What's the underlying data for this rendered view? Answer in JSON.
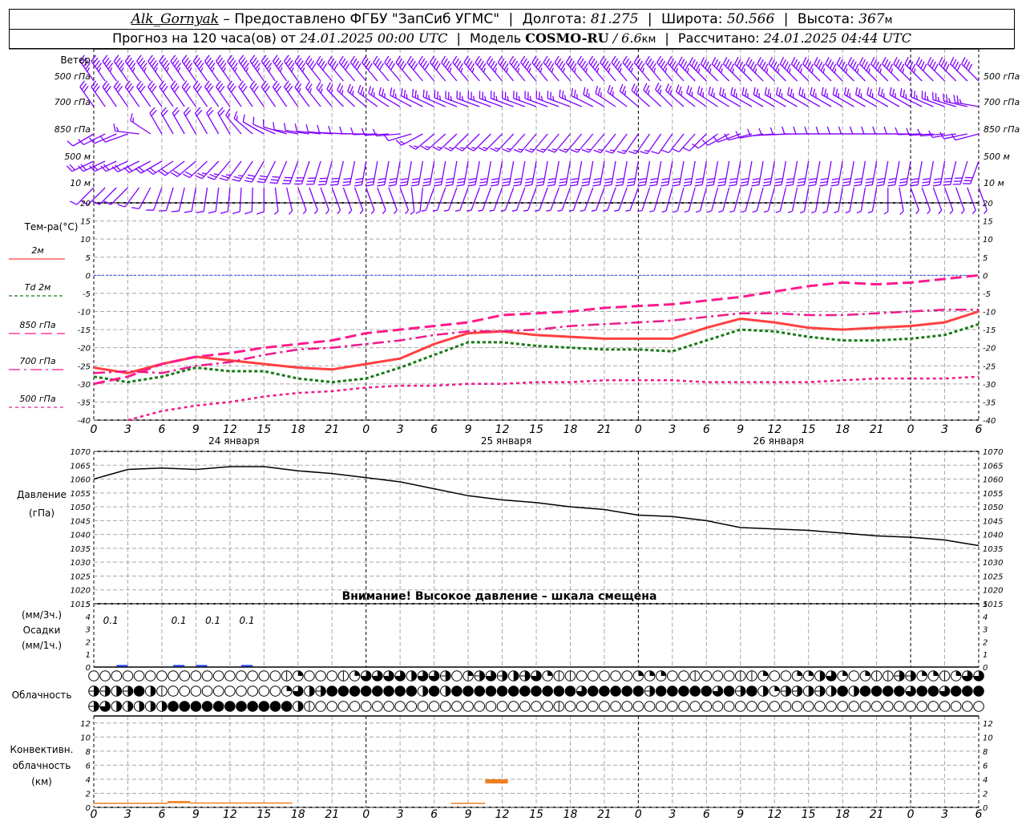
{
  "header": {
    "station": "Alk_Gornyak",
    "provider": "– Предоставлено ФГБУ \"ЗапСиб УГМС\"",
    "lon_label": "Долгота:",
    "lon": "81.275",
    "lat_label": "Широта:",
    "lat": "50.566",
    "alt_label": "Высота:",
    "alt": "367",
    "alt_unit": "м",
    "forecast_prefix": "Прогноз на 120 часа(ов) от",
    "forecast_start": "24.01.2025 00:00 UTC",
    "model_label": "Модель",
    "model": "COSMO-RU",
    "resolution": "/ 6.6",
    "res_unit": "км",
    "computed_label": "Рассчитано:",
    "computed": "24.01.2025 04:44 UTC"
  },
  "colors": {
    "wind": "#8000ff",
    "t2m": "#ff4040",
    "td2m": "#1a7a1a",
    "t850": "#ff1a8c",
    "t700": "#ee1a8c",
    "t500": "#ee1a8c",
    "zero_line": "#3050ff",
    "precip": "#2040ff",
    "convective": "#f08020",
    "grid": "#a8a8a8"
  },
  "x_axis": {
    "hours": [
      0,
      3,
      6,
      9,
      12,
      15,
      18,
      21,
      24,
      27,
      30,
      33,
      36,
      39,
      42,
      45,
      48,
      51,
      54,
      57,
      60,
      63,
      66,
      69,
      72,
      75,
      78
    ],
    "tick_labels": [
      "0",
      "3",
      "6",
      "9",
      "12",
      "15",
      "18",
      "21",
      "0",
      "3",
      "6",
      "9",
      "12",
      "15",
      "18",
      "21",
      "0",
      "3",
      "6",
      "9",
      "12",
      "15",
      "18",
      "21",
      "0",
      "3",
      "6"
    ],
    "day_boundaries": [
      24,
      48,
      72
    ],
    "dates": [
      {
        "label": "24 января",
        "hour": 12
      },
      {
        "label": "25 января",
        "hour": 36
      },
      {
        "label": "26 января",
        "hour": 60
      }
    ]
  },
  "labels": {
    "wind_title": "Ветер",
    "wind_levels": [
      "500 гПа",
      "700 гПа",
      "850 гПа",
      "500 м",
      "10  м"
    ],
    "temp_title": "Тем-ра(°C)",
    "temp_legend": [
      {
        "label": "2м",
        "series": "t2m"
      },
      {
        "label": "Td  2м",
        "series": "td2m"
      },
      {
        "label": "850 гПа",
        "series": "t850"
      },
      {
        "label": "700 гПа",
        "series": "t700"
      },
      {
        "label": "500 гПа",
        "series": "t500"
      }
    ],
    "pressure_title": "Давление",
    "pressure_unit": "(гПа)",
    "pressure_warning": "Внимание! Высокое давление – шкала смещена",
    "precip_unit3": "(мм/3ч.)",
    "precip_title": "Осадки",
    "precip_unit1": "(мм/1ч.)",
    "cloud_title": "Облачность",
    "conv_title1": "Конвективн.",
    "conv_title2": "облачность",
    "conv_unit": "(км)"
  },
  "chart_data": [
    {
      "type": "wind_barbs",
      "title": "Ветер",
      "hours": [
        0,
        3,
        6,
        9,
        12,
        15,
        18,
        21,
        24,
        27,
        30,
        33,
        36,
        39,
        42,
        45,
        48,
        51,
        54,
        57,
        60,
        63,
        66,
        69,
        72,
        75,
        78
      ],
      "levels": [
        {
          "name": "500 гПа",
          "dir_deg": [
            325,
            325,
            325,
            325,
            325,
            325,
            325,
            320,
            320,
            320,
            320,
            320,
            320,
            320,
            320,
            320,
            320,
            320,
            315,
            315,
            315,
            315,
            315,
            315,
            315,
            315,
            315
          ],
          "speed_ms": [
            22,
            22,
            22,
            22,
            22,
            22,
            22,
            20,
            20,
            20,
            20,
            22,
            22,
            22,
            22,
            22,
            22,
            22,
            22,
            22,
            22,
            22,
            22,
            22,
            22,
            20,
            20
          ]
        },
        {
          "name": "700 гПа",
          "dir_deg": [
            325,
            325,
            325,
            325,
            325,
            325,
            325,
            320,
            310,
            300,
            295,
            290,
            290,
            290,
            290,
            300,
            310,
            315,
            305,
            300,
            300,
            300,
            300,
            300,
            300,
            290,
            280
          ]
        },
        {
          "name": "850 гПа",
          "dir_deg": [
            240,
            250,
            330,
            330,
            330,
            300,
            280,
            275,
            270,
            265,
            230,
            225,
            225,
            220,
            220,
            220,
            215,
            215,
            225,
            250,
            265,
            270,
            270,
            270,
            270,
            265,
            255
          ]
        },
        {
          "name": "500 м",
          "dir_deg": [
            245,
            245,
            240,
            230,
            220,
            210,
            200,
            195,
            190,
            190,
            190,
            190,
            190,
            190,
            190,
            190,
            190,
            190,
            190,
            190,
            190,
            190,
            190,
            190,
            190,
            190,
            200
          ]
        },
        {
          "name": "10  м",
          "dir_deg": [
            225,
            225,
            200,
            190,
            185,
            180,
            160,
            160,
            160,
            160,
            200,
            200,
            200,
            200,
            200,
            200,
            200,
            195,
            195,
            195,
            195,
            190,
            190,
            190,
            160,
            160,
            160
          ]
        }
      ],
      "speeds_ms": {
        "700 гПа": [
          14,
          14,
          14,
          14,
          14,
          14,
          14,
          12,
          12,
          12,
          12,
          12,
          12,
          12,
          12,
          12,
          12,
          12,
          12,
          12,
          12,
          12,
          12,
          12,
          12,
          12,
          12
        ],
        "850 гПа": [
          5,
          6,
          10,
          10,
          10,
          6,
          5,
          5,
          5,
          5,
          7,
          7,
          7,
          7,
          7,
          7,
          7,
          6,
          5,
          4,
          4,
          4,
          4,
          4,
          4,
          5,
          5
        ],
        "500 м": [
          10,
          10,
          10,
          10,
          12,
          14,
          16,
          16,
          16,
          16,
          16,
          16,
          16,
          16,
          16,
          16,
          16,
          16,
          16,
          16,
          16,
          16,
          16,
          16,
          16,
          16,
          16
        ],
        "10  м": [
          5,
          5,
          6,
          6,
          6,
          4,
          3,
          3,
          3,
          3,
          3,
          3,
          3,
          3,
          3,
          3,
          3,
          3,
          3,
          3,
          3,
          3,
          3,
          3,
          3,
          3,
          3
        ]
      }
    },
    {
      "type": "line",
      "title": "Тем-ра(°C)",
      "ylim": [
        -40,
        20
      ],
      "yticks": [
        20,
        15,
        10,
        5,
        0,
        -5,
        -10,
        -15,
        -20,
        -25,
        -30,
        -35,
        -40
      ],
      "grid": true,
      "x": [
        0,
        3,
        6,
        9,
        12,
        15,
        18,
        21,
        24,
        27,
        30,
        33,
        36,
        39,
        42,
        45,
        48,
        51,
        54,
        57,
        60,
        63,
        66,
        69,
        72,
        75,
        78
      ],
      "series": [
        {
          "name": "2м",
          "key": "t2m",
          "values": [
            -25.5,
            -27,
            -24.5,
            -22.5,
            -23.5,
            -24.5,
            -25.5,
            -26,
            -24.5,
            -23,
            -19,
            -16,
            -15.5,
            -16.5,
            -17,
            -17.5,
            -17.5,
            -17.5,
            -14.5,
            -12,
            -13,
            -14.5,
            -15,
            -14.5,
            -14,
            -13,
            -10
          ]
        },
        {
          "name": "Td  2м",
          "key": "td2m",
          "values": [
            -28,
            -29.5,
            -28,
            -25.5,
            -26.5,
            -26.5,
            -28.5,
            -29.5,
            -28.5,
            -25.5,
            -22,
            -18.5,
            -18.5,
            -19.5,
            -20,
            -20.5,
            -20.5,
            -21,
            -18,
            -15,
            -15.5,
            -17,
            -18,
            -18,
            -17.5,
            -16.5,
            -13.5
          ]
        },
        {
          "name": "850 гПа",
          "key": "t850",
          "values": [
            -30,
            -28,
            -24.5,
            -22.5,
            -21.5,
            -20,
            -19,
            -18,
            -16,
            -15,
            -14,
            -13,
            -11,
            -10.5,
            -10,
            -9,
            -8.5,
            -8,
            -7,
            -6,
            -4.5,
            -3,
            -2,
            -2.5,
            -2,
            -1,
            0
          ]
        },
        {
          "name": "700 гПа",
          "key": "t700",
          "values": [
            -27,
            -26.5,
            -27,
            -25,
            -24,
            -22,
            -20.5,
            -20,
            -19,
            -18,
            -16.5,
            -15.5,
            -15.5,
            -15,
            -14,
            -13.5,
            -13,
            -12.5,
            -11.5,
            -10.5,
            -10.5,
            -11,
            -11,
            -10.5,
            -10,
            -9.5,
            -9.5
          ]
        },
        {
          "name": "500 гПа",
          "key": "t500",
          "values": [
            null,
            -40.5,
            -37.5,
            -36,
            -35,
            -33.5,
            -32.5,
            -32,
            -31,
            -30.5,
            -30.5,
            -30,
            -30,
            -29.5,
            -29.5,
            -29,
            -29,
            -29,
            -29.5,
            -29.5,
            -29.5,
            -29.5,
            -29,
            -28.5,
            -28.5,
            -28.5,
            -28
          ]
        }
      ]
    },
    {
      "type": "line",
      "title": "Давление",
      "ylabel": "(гПа)",
      "ylim": [
        1015,
        1070
      ],
      "yticks": [
        1070,
        1065,
        1060,
        1055,
        1050,
        1045,
        1040,
        1035,
        1030,
        1025,
        1020,
        1015
      ],
      "grid": true,
      "x": [
        0,
        3,
        6,
        9,
        12,
        15,
        18,
        21,
        24,
        27,
        30,
        33,
        36,
        39,
        42,
        45,
        48,
        51,
        54,
        57,
        60,
        63,
        66,
        69,
        72,
        75,
        78
      ],
      "series": [
        {
          "key": "pressure",
          "values": [
            1060,
            1063.5,
            1064,
            1063.5,
            1064.5,
            1064.5,
            1063,
            1062,
            1060.5,
            1059,
            1056.5,
            1054,
            1052.5,
            1051.5,
            1050,
            1049,
            1047,
            1046.5,
            1045,
            1042.5,
            1042,
            1041.5,
            1040.5,
            1039.5,
            1039,
            1038,
            1036
          ]
        }
      ]
    },
    {
      "type": "bar",
      "title": "Осадки",
      "ylim": [
        0,
        5
      ],
      "yticks": [
        5,
        4,
        3,
        2,
        1,
        0
      ],
      "bars_mm_1h": [
        {
          "hour": 2,
          "value": 0.1
        },
        {
          "hour": 7,
          "value": 0.1
        },
        {
          "hour": 9,
          "value": 0.1
        },
        {
          "hour": 13,
          "value": 0.1
        }
      ],
      "labels_mm_3h": [
        {
          "hour": 1.5,
          "text": "0.1"
        },
        {
          "hour": 7.5,
          "text": "0.1"
        },
        {
          "hour": 10.5,
          "text": "0.1"
        },
        {
          "hour": 13.5,
          "text": "0.1"
        }
      ]
    },
    {
      "type": "cloud_symbols",
      "title": "Облачность",
      "unit": "oktas per hour",
      "rows": [
        "0000000000000000012000126666466503565456211000002220010001120022462021155221266",
        "5545841000000000026458888888848488888888888688888588888685842554548488886886888",
        "5644444888888888884100000000000000000000010000000000000000000000000000000000000"
      ]
    },
    {
      "type": "bar",
      "title": "Конвективн. облачность",
      "ylabel": "(км)",
      "ylim": [
        0,
        13
      ],
      "yticks": [
        12,
        10,
        8,
        6,
        4,
        2,
        0
      ],
      "grid": true,
      "layers_km": [
        {
          "from_hour": 0,
          "to_hour": 6.5,
          "base": 0.55,
          "top": 0.65
        },
        {
          "from_hour": 6.5,
          "to_hour": 8.5,
          "base": 0.6,
          "top": 0.9
        },
        {
          "from_hour": 8.5,
          "to_hour": 17.5,
          "base": 0.55,
          "top": 0.7
        },
        {
          "from_hour": 31.5,
          "to_hour": 34.5,
          "base": 0.55,
          "top": 0.65
        },
        {
          "from_hour": 34.5,
          "to_hour": 36.5,
          "base": 3.4,
          "top": 4.0
        }
      ]
    }
  ]
}
